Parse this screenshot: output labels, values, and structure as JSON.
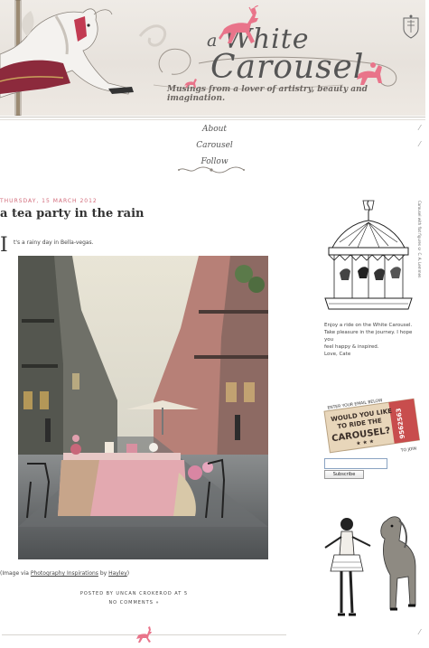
{
  "header": {
    "brand_a": "a",
    "brand_white": "White",
    "brand_carousel": "Carousel",
    "tagline": "Musings from a lover of artistry, beauty and imagination."
  },
  "nav": {
    "items": [
      "About",
      "Carousel",
      "Follow"
    ]
  },
  "post": {
    "date": "THURSDAY, 15 MARCH 2012",
    "title": "a tea party in the rain",
    "dropcap": "I",
    "text": "t's a rainy day in Bella-vegas.",
    "caption_prefix": "(Image via ",
    "caption_link1": "Photography Inspirations",
    "caption_mid": " by ",
    "caption_link2": "Hayley",
    "caption_suffix": ")",
    "posted_by": "POSTED BY UNCAN CROKEROD AT 5",
    "comments": "NO COMMENTS »"
  },
  "sidebar": {
    "vertical_credit": "Carousel with flat figures © C. A. Lemmen",
    "intro_lines": [
      "Enjoy a ride on the White Carousel.",
      "Take pleasure in the journey. I hope you",
      "feel happy & inspired.",
      "Love, Cate"
    ],
    "ticket": {
      "top": "ENTER YOUR EMAIL BELOW",
      "line1": "WOULD YOU LIKE",
      "line2": "TO RIDE THE",
      "line3": "CAROUSEL?",
      "number": "9562563",
      "bottom": "TO JOIN"
    },
    "subscribe_label": "Subscribe"
  },
  "colors": {
    "accent_pink": "#e9748a",
    "date_pink": "#d26b7a",
    "header_bg": "#e9e4de"
  }
}
